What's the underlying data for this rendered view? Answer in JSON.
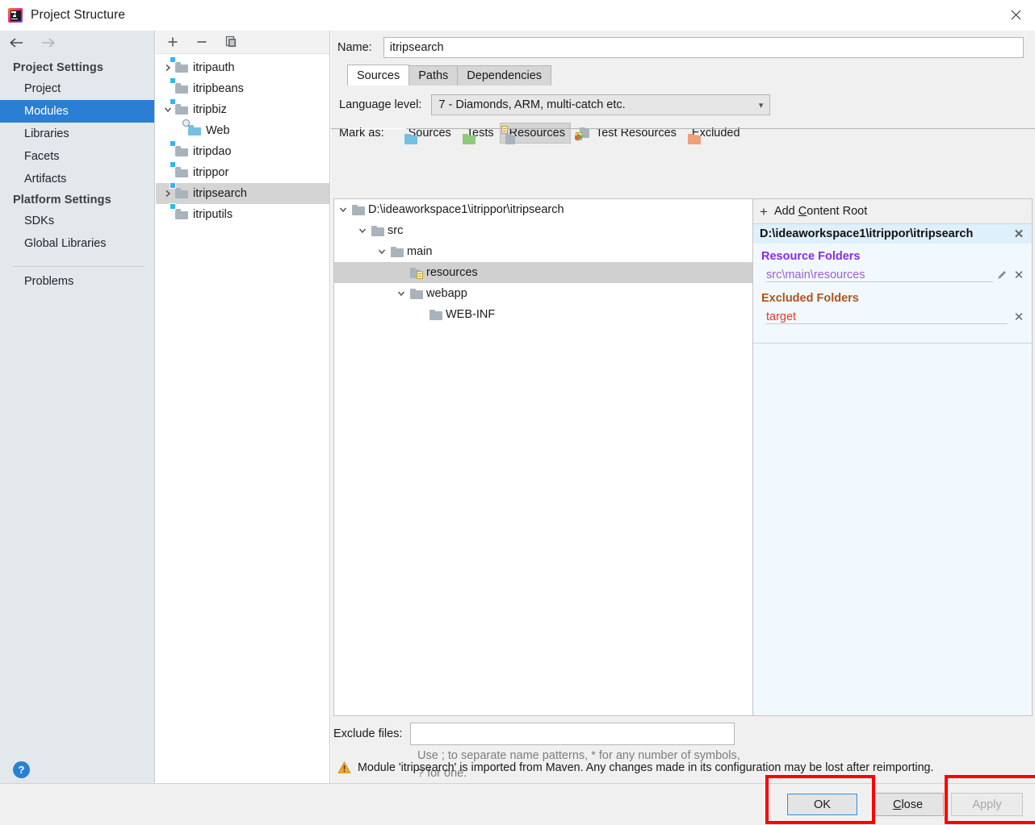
{
  "window": {
    "title": "Project Structure",
    "app_icon": "intellij-idea-logo",
    "close_icon": "close-icon"
  },
  "sidebar": {
    "back_icon": "back-arrow-icon",
    "forward_icon": "forward-arrow-icon",
    "groups": [
      {
        "title": "Project Settings",
        "items": [
          {
            "label": "Project",
            "selected": false
          },
          {
            "label": "Modules",
            "selected": true
          },
          {
            "label": "Libraries",
            "selected": false
          },
          {
            "label": "Facets",
            "selected": false
          },
          {
            "label": "Artifacts",
            "selected": false
          }
        ]
      },
      {
        "title": "Platform Settings",
        "items": [
          {
            "label": "SDKs",
            "selected": false
          },
          {
            "label": "Global Libraries",
            "selected": false
          }
        ]
      }
    ],
    "problems_label": "Problems",
    "help_label": "?"
  },
  "modules_panel": {
    "toolbar": {
      "add_icon": "plus-icon",
      "remove_icon": "minus-icon",
      "copy_icon": "copy-icon"
    },
    "tree": [
      {
        "label": "itripauth",
        "indent": 0,
        "twisty": "collapsed",
        "icon": "module-folder-icon",
        "selected": false
      },
      {
        "label": "itripbeans",
        "indent": 0,
        "twisty": "none",
        "icon": "module-folder-icon",
        "selected": false
      },
      {
        "label": "itripbiz",
        "indent": 0,
        "twisty": "expanded",
        "icon": "module-folder-icon",
        "selected": false
      },
      {
        "label": "Web",
        "indent": 1,
        "twisty": "none",
        "icon": "web-facet-icon",
        "selected": false
      },
      {
        "label": "itripdao",
        "indent": 0,
        "twisty": "none",
        "icon": "module-folder-icon",
        "selected": false
      },
      {
        "label": "itrippor",
        "indent": 0,
        "twisty": "none",
        "icon": "module-folder-icon",
        "selected": false
      },
      {
        "label": "itripsearch",
        "indent": 0,
        "twisty": "collapsed",
        "icon": "module-folder-icon",
        "selected": true
      },
      {
        "label": "itriputils",
        "indent": 0,
        "twisty": "none",
        "icon": "module-folder-icon",
        "selected": false
      }
    ]
  },
  "content": {
    "name_label": "Name:",
    "name_value": "itripsearch",
    "tabs": [
      {
        "label": "Sources",
        "active": true
      },
      {
        "label": "Paths",
        "active": false
      },
      {
        "label": "Dependencies",
        "active": false
      }
    ],
    "language_level_label": "Language level:",
    "language_level_value": "7 - Diamonds, ARM, multi-catch etc.",
    "language_level_chevron": "chevron-down-icon",
    "mark_as_label": "Mark as:",
    "mark_as_buttons": [
      {
        "label": "Sources",
        "mnemonic": "S",
        "rest": "ources",
        "icon": "sources-folder-icon",
        "active": false
      },
      {
        "label": "Tests",
        "mnemonic": "T",
        "rest": "ests",
        "icon": "tests-folder-icon",
        "active": false
      },
      {
        "label": "Resources",
        "mnemonic": "",
        "rest": "Resources",
        "icon": "resources-folder-icon",
        "active": true
      },
      {
        "label": "Test Resources",
        "mnemonic": "",
        "rest": "Test Resources",
        "icon": "test-resources-folder-icon",
        "active": false
      },
      {
        "label": "Excluded",
        "mnemonic": "E",
        "rest": "xcluded",
        "icon": "excluded-folder-icon",
        "active": false
      }
    ],
    "folder_tree": [
      {
        "label": "D:\\ideaworkspace1\\itrippor\\itripsearch",
        "indent": 0,
        "twisty": "expanded",
        "icon": "folder-icon",
        "selected": false
      },
      {
        "label": "src",
        "indent": 1,
        "twisty": "expanded",
        "icon": "folder-icon",
        "selected": false
      },
      {
        "label": "main",
        "indent": 2,
        "twisty": "expanded",
        "icon": "folder-icon",
        "selected": false
      },
      {
        "label": "resources",
        "indent": 3,
        "twisty": "none",
        "icon": "resources-folder-icon",
        "selected": true
      },
      {
        "label": "webapp",
        "indent": 2,
        "twisty": "expanded",
        "icon": "folder-icon",
        "selected": false
      },
      {
        "label": "WEB-INF",
        "indent": 3,
        "twisty": "none",
        "icon": "folder-icon",
        "selected": false
      }
    ],
    "exclude_files_label": "Exclude files:",
    "exclude_files_value": "",
    "exclude_hint": "Use ; to separate name patterns, * for any number of symbols, ? for one.",
    "warning_icon": "warning-triangle-icon",
    "warning_text": "Module 'itripsearch' is imported from Maven. Any changes made in its configuration may be lost after reimporting."
  },
  "info_panel": {
    "add_content_root": {
      "plus": "+",
      "label_mnemonic": "Add ",
      "label_mnem_char": "C",
      "label_rest": "ontent Root"
    },
    "content_root_path": "D:\\ideaworkspace1\\itrippor\\itripsearch",
    "content_root_remove_icon": "close-icon",
    "sections": [
      {
        "title": "Resource Folders",
        "color": "#8a2be2",
        "entries": [
          {
            "path": "src\\main\\resources",
            "has_edit": true,
            "edit_icon": "pencil-icon",
            "remove_icon": "close-icon"
          }
        ]
      },
      {
        "title": "Excluded Folders",
        "color": "#b0541a",
        "entries": [
          {
            "path": "target",
            "has_edit": false,
            "remove_icon": "close-icon"
          }
        ]
      }
    ]
  },
  "buttons": {
    "ok": "OK",
    "close_mnem": "C",
    "close_rest": "lose",
    "close": "Close",
    "apply": "Apply",
    "apply_disabled": true
  },
  "annotations": {
    "color": "#ff0000",
    "boxes": [
      "ok-button-highlight",
      "apply-button-highlight"
    ]
  }
}
